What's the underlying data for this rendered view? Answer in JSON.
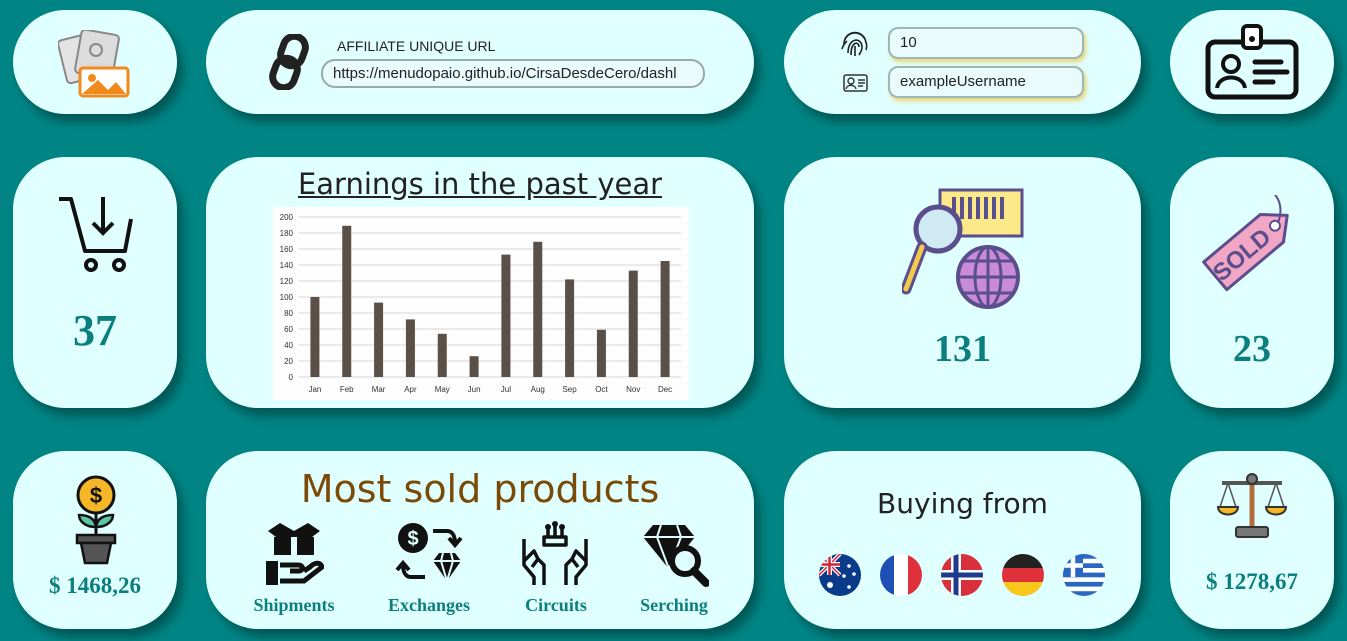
{
  "affiliate": {
    "label": "AFFILIATE UNIQUE URL",
    "url": "https://menudopaio.github.io/CirsaDesdeCero/dashl"
  },
  "login": {
    "id_value": "10",
    "username_value": "exampleUsername"
  },
  "stats": {
    "cart_count": "37",
    "global_count": "131",
    "sold_count": "23",
    "investment": "$ 1468,26",
    "balance": "$ 1278,67"
  },
  "earnings": {
    "title": "Earnings in the past year"
  },
  "chart_data": {
    "type": "bar",
    "categories": [
      "Jan",
      "Feb",
      "Mar",
      "Apr",
      "May",
      "Jun",
      "Jul",
      "Aug",
      "Sep",
      "Oct",
      "Nov",
      "Dec"
    ],
    "values": [
      100,
      189,
      93,
      72,
      54,
      26,
      153,
      169,
      122,
      59,
      133,
      145
    ],
    "ylim": [
      0,
      200
    ],
    "yticks": [
      "0",
      "20",
      "40",
      "60",
      "80",
      "100",
      "120",
      "140",
      "160",
      "180",
      "200"
    ],
    "bar_color": "#5a5048",
    "grid": true
  },
  "products": {
    "title": "Most sold products",
    "items": [
      {
        "label": "Shipments",
        "icon": "box-hand-icon"
      },
      {
        "label": "Exchanges",
        "icon": "exchange-icon"
      },
      {
        "label": "Circuits",
        "icon": "circuit-icon"
      },
      {
        "label": "Serching",
        "icon": "diamond-search-icon"
      }
    ]
  },
  "buying": {
    "title": "Buying from",
    "flags": [
      "australia",
      "france",
      "norway",
      "germany",
      "greece"
    ]
  },
  "colors": {
    "background": "#008584",
    "card": "#e0ffff",
    "accent": "#0b7f7e",
    "products_title": "#7a4a06"
  }
}
